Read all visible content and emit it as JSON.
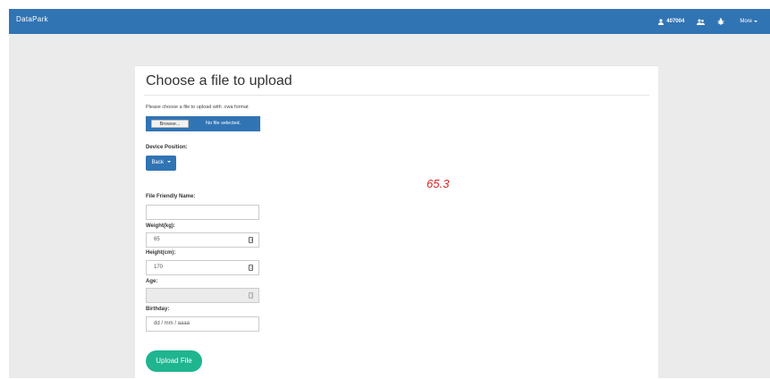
{
  "navbar": {
    "brand": "DataPark",
    "user_label": "407004",
    "more_label": "More",
    "icons": [
      "user-icon",
      "users-icon",
      "bug-icon"
    ]
  },
  "colors": {
    "navbar": "#3174b4",
    "page_background": "#ebebeb",
    "upload_button": "#1fb58f",
    "annotation": "#e02424"
  },
  "form": {
    "title": "Choose a file to upload",
    "hint": "Please choose a file to upload with .cwa format",
    "file": {
      "browse_label": "Browse...",
      "status": "No file selected."
    },
    "device_position": {
      "label": "Device Position:",
      "selected": "Back"
    },
    "friendly_name": {
      "label": "File Friendly Name:",
      "value": ""
    },
    "weight": {
      "label": "Weight(kg):",
      "value": "65"
    },
    "height": {
      "label": "Height(cm):",
      "value": "170"
    },
    "age": {
      "label": "Age:",
      "value": ""
    },
    "birthday": {
      "label": "Birthday:",
      "value": "dd / mm / aaaa"
    },
    "upload_label": "Upload File"
  },
  "annotation": {
    "text": "65.3"
  }
}
